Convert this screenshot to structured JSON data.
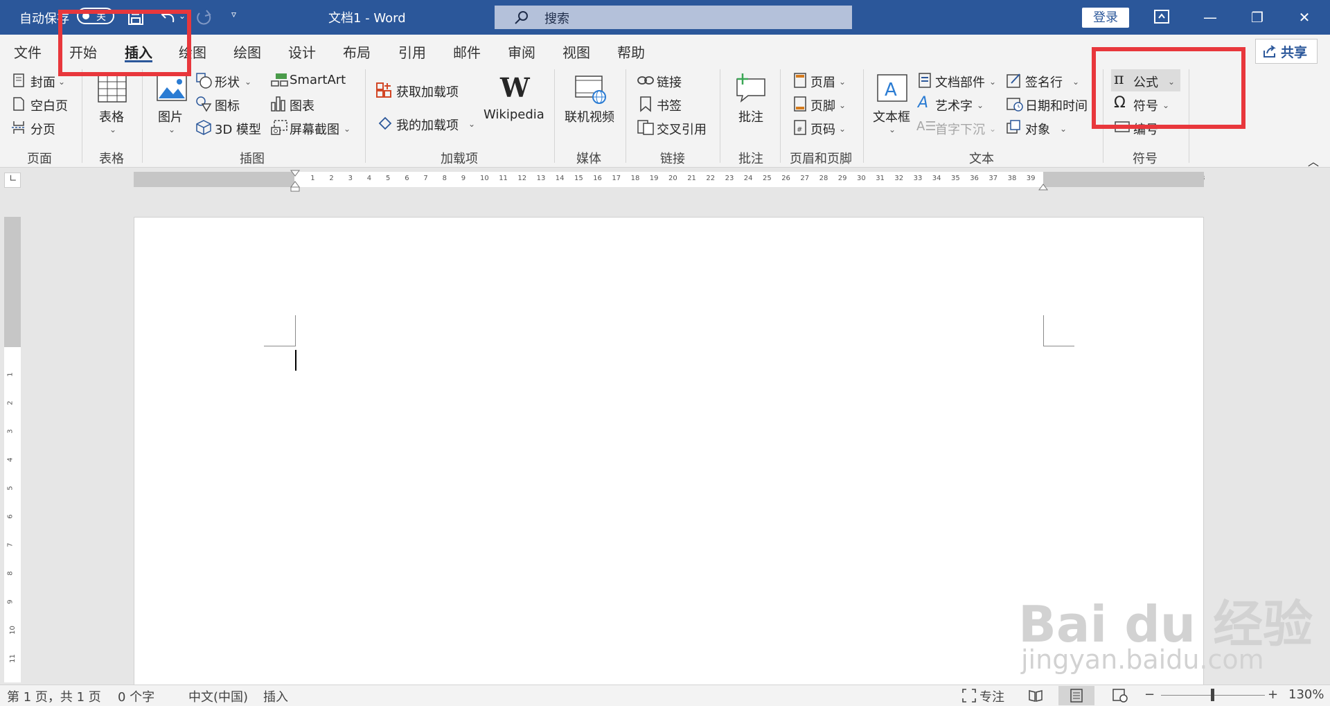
{
  "title_bar": {
    "autosave_label": "自动保存",
    "autosave_state": "关",
    "doc_title": "文档1  -  Word",
    "search_placeholder": "搜索",
    "signin_label": "登录",
    "minimize": "—",
    "restore": "❐",
    "close": "✕"
  },
  "tabs": [
    "文件",
    "开始",
    "插入",
    "绘图",
    "绘图",
    "设计",
    "布局",
    "引用",
    "邮件",
    "审阅",
    "视图",
    "帮助"
  ],
  "active_tab": "插入",
  "share_label": "共享",
  "ribbon": {
    "pages": {
      "cover": "封面",
      "blank": "空白页",
      "break": "分页",
      "group": "页面"
    },
    "tables": {
      "table": "表格",
      "group": "表格"
    },
    "illustrations": {
      "pictures": "图片",
      "shapes": "形状",
      "icons": "图标",
      "model3d": "3D 模型",
      "smartart": "SmartArt",
      "chart": "图表",
      "screenshot": "屏幕截图",
      "group": "插图"
    },
    "addins": {
      "get": "获取加载项",
      "my": "我的加载项",
      "wikipedia": "Wikipedia",
      "group": "加载项"
    },
    "media": {
      "video": "联机视频",
      "group": "媒体"
    },
    "links": {
      "link": "链接",
      "bookmark": "书签",
      "crossref": "交叉引用",
      "group": "链接"
    },
    "comments": {
      "comment": "批注",
      "group": "批注"
    },
    "header_footer": {
      "header": "页眉",
      "footer": "页脚",
      "page_number": "页码",
      "group": "页眉和页脚"
    },
    "text": {
      "textbox": "文本框",
      "quickparts": "文档部件",
      "wordart": "艺术字",
      "dropcap": "首字下沉",
      "signature": "签名行",
      "datetime": "日期和时间",
      "object": "对象",
      "group": "文本"
    },
    "symbols": {
      "equation": "公式",
      "symbol": "符号",
      "number": "编号",
      "group": "符号"
    }
  },
  "status_bar": {
    "page": "第 1 页，共 1 页",
    "words": "0 个字",
    "language": "中文(中国)",
    "mode": "插入",
    "focus": "专注",
    "zoom": "130%"
  },
  "watermark": {
    "brand": "Bai du 经验",
    "url": "jingyan.baidu.com"
  },
  "colors": {
    "title_bar": "#2b579a",
    "ribbon": "#f3f3f3",
    "highlight": "#e8373c"
  }
}
